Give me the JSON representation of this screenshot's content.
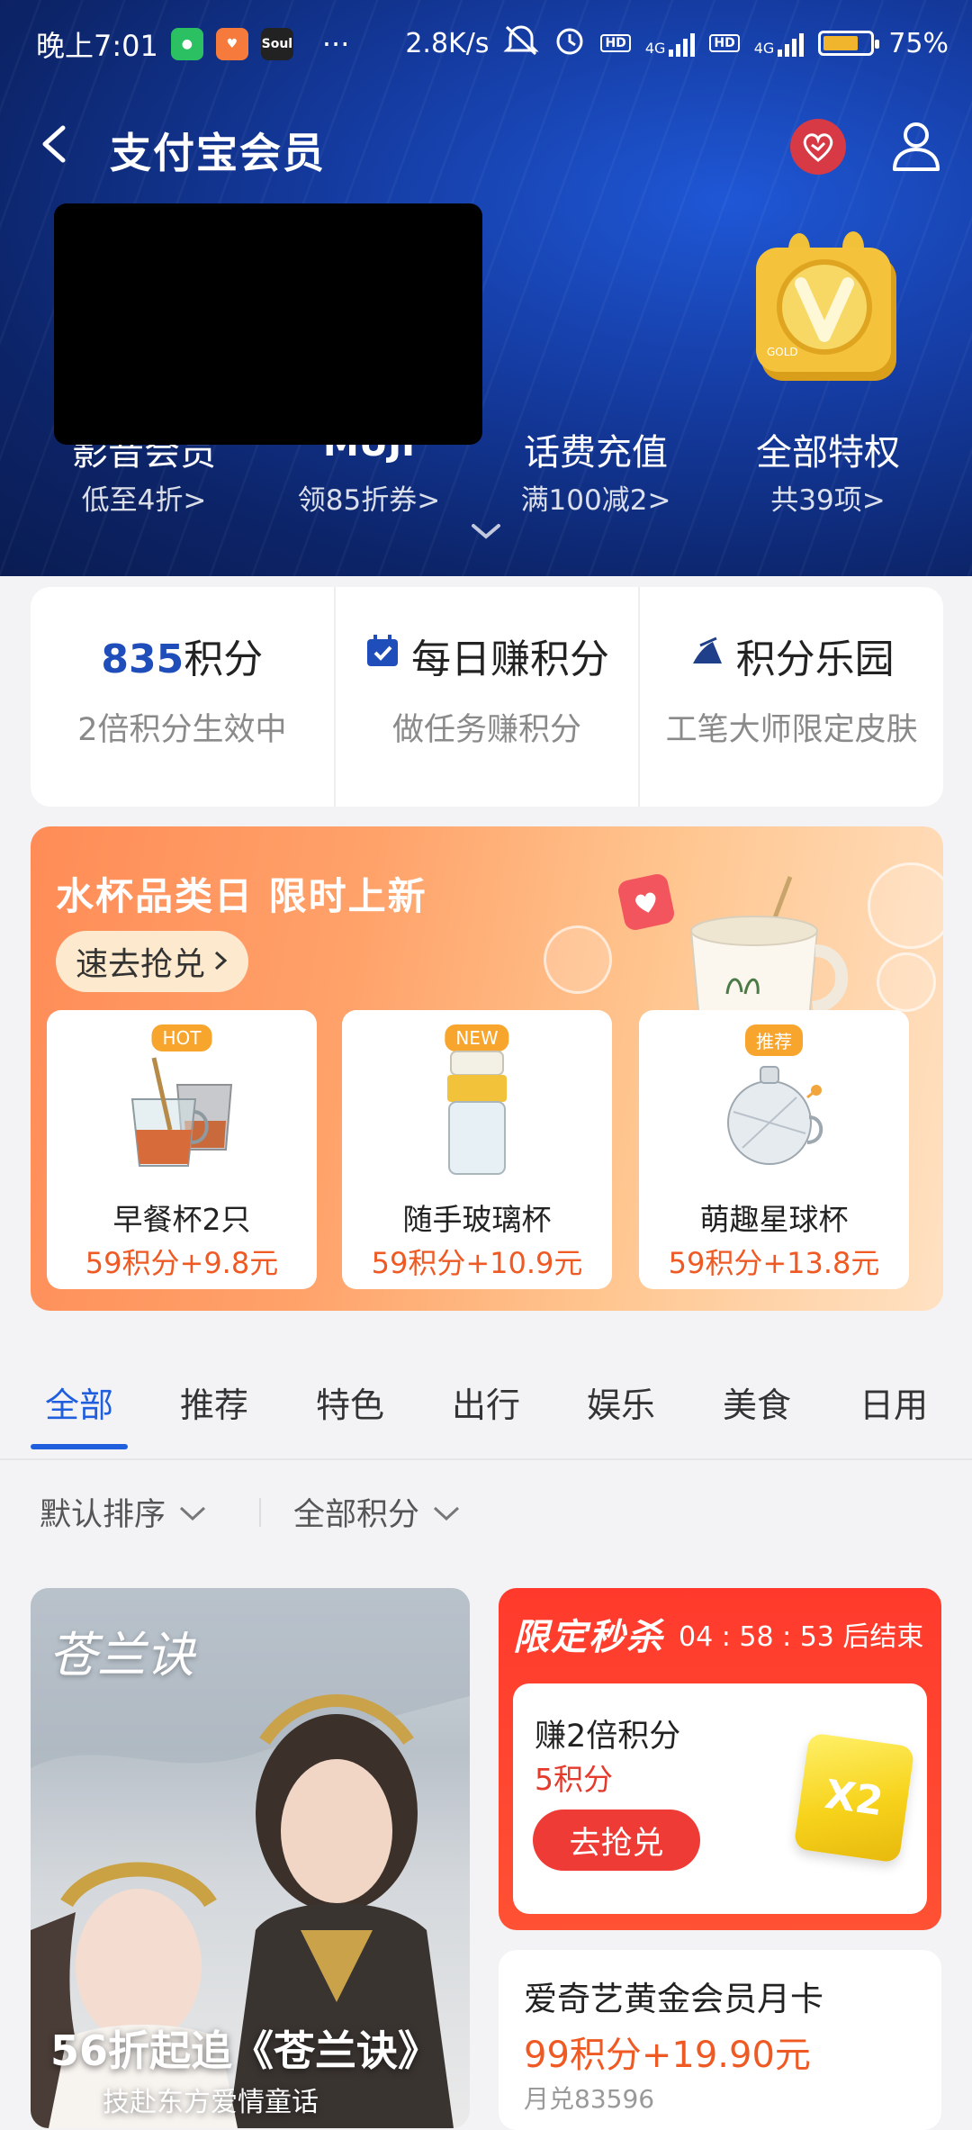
{
  "status_bar": {
    "time": "晚上7:01",
    "apps": [
      "wechat",
      "heart-app",
      "Soul"
    ],
    "more": "···",
    "speed": "2.8K/s",
    "network1": "4G",
    "network2": "4G",
    "battery": "75%",
    "battery_level": 0.75
  },
  "nav": {
    "title": "支付宝会员"
  },
  "privileges": [
    {
      "name": "影音会员",
      "sub": "低至4折>"
    },
    {
      "name": "MUJI",
      "sub": "领85折券>"
    },
    {
      "name": "话费充值",
      "sub": "满100减2>"
    },
    {
      "name": "全部特权",
      "sub": "共39项>"
    }
  ],
  "points": {
    "balance": "835",
    "balance_unit": "积分",
    "balance_sub": "2倍积分生效中",
    "daily_title": "每日赚积分",
    "daily_sub": "做任务赚积分",
    "park_title": "积分乐园",
    "park_sub": "工笔大师限定皮肤"
  },
  "promo": {
    "title": "水杯品类日 限时上新",
    "button": "速去抢兑",
    "items": [
      {
        "tag": "HOT",
        "name": "早餐杯2只",
        "price": "59积分+9.8元"
      },
      {
        "tag": "NEW",
        "name": "随手玻璃杯",
        "price": "59积分+10.9元"
      },
      {
        "tag": "推荐",
        "name": "萌趣星球杯",
        "price": "59积分+13.8元"
      }
    ]
  },
  "tabs": [
    "全部",
    "推荐",
    "特色",
    "出行",
    "娱乐",
    "美食",
    "日用"
  ],
  "filters": {
    "sort": "默认排序",
    "points": "全部积分"
  },
  "film_card": {
    "logo": "苍兰诀",
    "caption": "56折起追《苍兰诀》",
    "caption2": "技赴东方爱情童话"
  },
  "flash_sale": {
    "label": "限定秒杀",
    "timer": "04 : 58 : 53 后结束",
    "name": "赚2倍积分",
    "points": "5积分",
    "button": "去抢兑",
    "badge": "X2"
  },
  "vip_card": {
    "name": "爱奇艺黄金会员月卡",
    "price": "99积分+19.90元",
    "sold": "月兑83596"
  }
}
